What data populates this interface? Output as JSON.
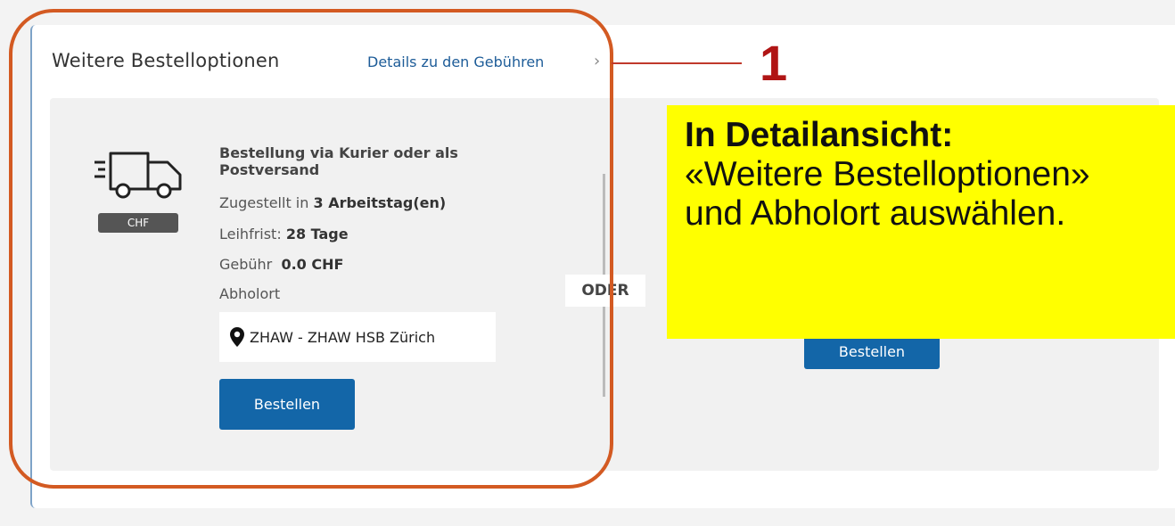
{
  "section": {
    "title": "Weitere Bestelloptionen",
    "details_link": "Details zu den Gebühren"
  },
  "option_courier": {
    "icon": "truck-icon",
    "badge": "CHF",
    "title": "Bestellung via Kurier oder als Postversand",
    "delivered_label": "Zugestellt in",
    "delivered_value": "3 Arbeitstag(en)",
    "loan_label": "Leihfrist:",
    "loan_value": "28 Tage",
    "fee_label": "Gebühr",
    "fee_value": "0.0 CHF",
    "pickup_label": "Abholort",
    "pickup_location": "ZHAW - ZHAW HSB Zürich",
    "order_button": "Bestellen"
  },
  "separator": "ODER",
  "option_pickup": {
    "order_button": "Bestellen"
  },
  "annotation": {
    "callout_number": "1",
    "note_heading": "In Detailansicht:",
    "note_body": "«Weitere Bestelloptionen» und Abholort auswählen.",
    "ring_color": "#d35a22",
    "note_color": "#ffff00"
  },
  "colors": {
    "primary_button": "#1366a8",
    "link": "#1d5c98"
  }
}
